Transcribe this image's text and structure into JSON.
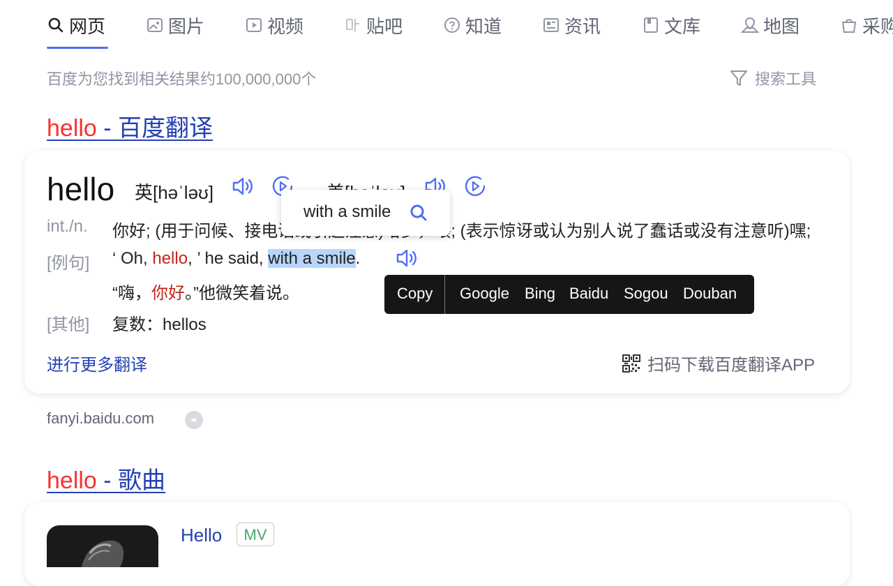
{
  "tabs": [
    {
      "label": "网页",
      "icon": "search-icon",
      "active": true
    },
    {
      "label": "图片",
      "icon": "image-icon"
    },
    {
      "label": "视频",
      "icon": "video-icon"
    },
    {
      "label": "贴吧",
      "icon": "tieba-icon"
    },
    {
      "label": "知道",
      "icon": "question-icon"
    },
    {
      "label": "资讯",
      "icon": "news-icon"
    },
    {
      "label": "文库",
      "icon": "doc-icon"
    },
    {
      "label": "地图",
      "icon": "map-icon"
    },
    {
      "label": "采购",
      "icon": "bag-icon"
    }
  ],
  "result_count": "百度为您找到相关结果约100,000,000个",
  "search_tools": "搜索工具",
  "result1": {
    "title_kw": "hello",
    "title_rest": " - 百度翻译",
    "word": "hello",
    "uk_phonetic": "英[həˈləʊ]",
    "us_phonetic": "美[həˈloʊ]",
    "pos": "int./n.",
    "definition": "你好; (用于问候、接电话或引起注意)哈罗，喂; (表示惊讶或认为别人说了蠢话或没有注意听)嘿;",
    "example_label": "[例句]",
    "example_en_pre": "‘ Oh, ",
    "example_en_kw": "hello",
    "example_en_mid": ", ’ he said, ",
    "example_en_hl": "with a smile",
    "example_en_post": ".",
    "example_zh_pre": "“嗨，",
    "example_zh_kw": "你好",
    "example_zh_post": "。”他微笑着说。",
    "other_label": "[其他]",
    "other_text": "复数：hellos",
    "more_translation": "进行更多翻译",
    "scan_download": "扫码下载百度翻译APP",
    "site": "fanyi.baidu.com"
  },
  "popup": {
    "text": "with a smile"
  },
  "context_bar": {
    "copy": "Copy",
    "engines": [
      "Google",
      "Bing",
      "Baidu",
      "Sogou",
      "Douban"
    ]
  },
  "result2": {
    "title_kw": "hello",
    "title_rest": " - 歌曲",
    "song_title": "Hello",
    "badge": "MV"
  },
  "colors": {
    "accent": "#4e6ef2",
    "link": "#2440b3",
    "keyword": "#f73131"
  }
}
